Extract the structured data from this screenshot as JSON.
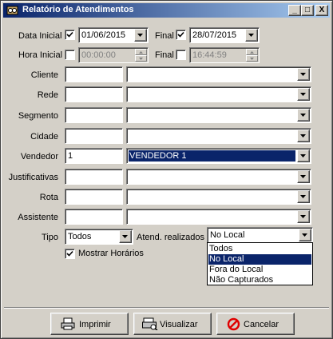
{
  "window": {
    "title": "Relatório de Atendimentos",
    "minimize_glyph": "_",
    "maximize_glyph": "□",
    "close_glyph": "X"
  },
  "date_row": {
    "label": "Data Inicial",
    "start_checked": true,
    "start_value": "01/06/2015",
    "end_label": "Final",
    "end_checked": true,
    "end_value": "28/07/2015"
  },
  "time_row": {
    "label": "Hora Inicial",
    "start_checked": false,
    "start_value": "00:00:00",
    "end_label": "Final",
    "end_checked": false,
    "end_value": "16:44:59"
  },
  "filters": [
    {
      "label": "Cliente",
      "code": "",
      "name": ""
    },
    {
      "label": "Rede",
      "code": "",
      "name": ""
    },
    {
      "label": "Segmento",
      "code": "",
      "name": ""
    },
    {
      "label": "Cidade",
      "code": "",
      "name": ""
    },
    {
      "label": "Vendedor",
      "code": "1",
      "name": "VENDEDOR 1"
    },
    {
      "label": "Justificativas",
      "code": "",
      "name": ""
    },
    {
      "label": "Rota",
      "code": "",
      "name": ""
    },
    {
      "label": "Assistente",
      "code": "",
      "name": ""
    }
  ],
  "tipo": {
    "label": "Tipo",
    "value": "Todos"
  },
  "atend": {
    "label": "Atend. realizados",
    "value": "No Local",
    "options": [
      "Todos",
      "No Local",
      "Fora do Local",
      "Não Capturados"
    ],
    "highlighted_index": 1
  },
  "show_hours": {
    "label": "Mostrar Horários",
    "checked": true
  },
  "buttons": {
    "print": "Imprimir",
    "preview": "Visualizar",
    "cancel": "Cancelar"
  },
  "colors": {
    "titlebar_start": "#0a246a",
    "titlebar_end": "#a6caf0",
    "selection": "#0a246a",
    "cancel_icon": "#e00000"
  }
}
